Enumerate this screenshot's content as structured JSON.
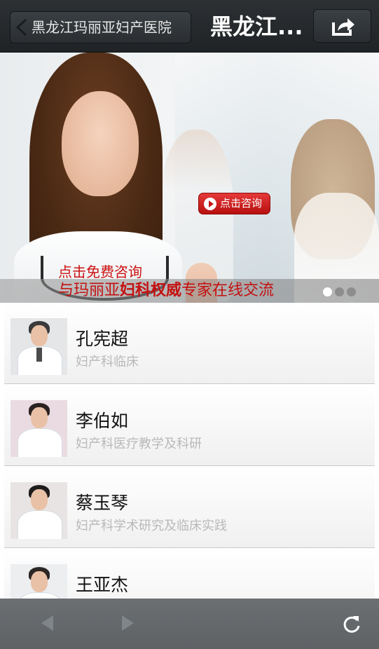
{
  "header": {
    "back_label": "黑龙江玛丽亚妇产医院",
    "title": "黑龙江..."
  },
  "banner": {
    "consult_button": "点击咨询",
    "headline_line1": "点击免费咨询",
    "headline_part1": "与玛丽亚",
    "headline_highlight": "妇科权威",
    "headline_part2": "专家在线交流",
    "slides_total": 3,
    "active_slide": 1
  },
  "doctors": [
    {
      "name": "孔宪超",
      "department": "妇产科临床"
    },
    {
      "name": "李伯如",
      "department": "妇产科医疗教学及科研"
    },
    {
      "name": "蔡玉琴",
      "department": "妇产科学术研究及临床实践"
    },
    {
      "name": "王亚杰",
      "department": ""
    }
  ],
  "toolbar": {
    "back_icon": "arrow-left-icon",
    "forward_icon": "arrow-right-icon",
    "refresh_icon": "refresh-icon"
  },
  "colors": {
    "accent_red": "#c41010",
    "topbar": "#262a2d",
    "toolbar": "#65696c"
  }
}
